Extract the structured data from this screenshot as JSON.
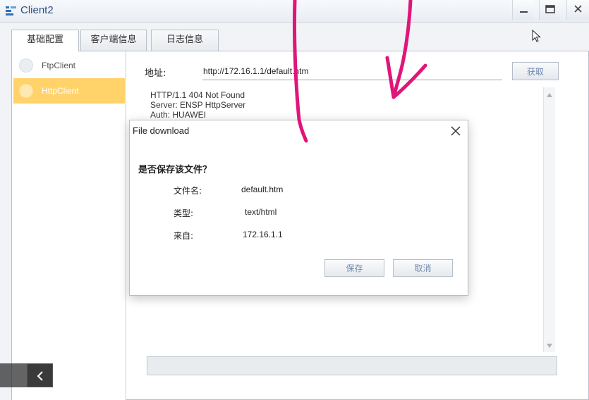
{
  "window": {
    "title": "Client2"
  },
  "tabs": [
    {
      "label": "基础配置"
    },
    {
      "label": "客户端信息"
    },
    {
      "label": "日志信息"
    }
  ],
  "sidebar": {
    "items": [
      {
        "label": "FtpClient"
      },
      {
        "label": "HttpClient"
      }
    ]
  },
  "address": {
    "label": "地址:",
    "value": "http://172.16.1.1/default.htm",
    "fetch_label": "获取"
  },
  "response": {
    "lines": [
      "HTTP/1.1 404 Not Found",
      "Server: ENSP HttpServer",
      "Auth: HUAWEI"
    ]
  },
  "dialog": {
    "title": "File download",
    "question": "是否保存该文件？",
    "filename_label": "文件名:",
    "filename_value": "default.htm",
    "type_label": "类型:",
    "type_value": "text/html",
    "from_label": "来自:",
    "from_value": "172.16.1.1",
    "save_label": "保存",
    "cancel_label": "取消"
  },
  "colors": {
    "selected_item": "#ffd36a",
    "ink": "#e0157a",
    "title_text": "#2b4f7e"
  }
}
